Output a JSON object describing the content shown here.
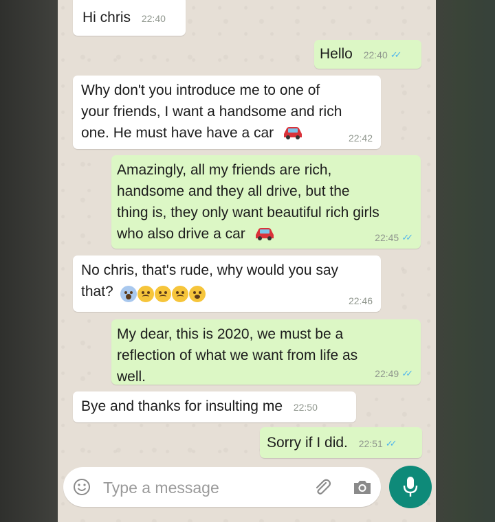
{
  "messages": [
    {
      "direction": "incoming",
      "text": "Hi chris",
      "time": "22:40"
    },
    {
      "direction": "outgoing",
      "text": "Hello",
      "time": "22:40",
      "status": "read"
    },
    {
      "direction": "incoming",
      "text": "Why don't you introduce me to one of\nyour friends, I want a handsome and rich\none. He must have have a car",
      "time": "22:42",
      "emoji": [
        "car-emoji"
      ]
    },
    {
      "direction": "outgoing",
      "text": "Amazingly, all my friends are rich,\nhandsome and they all drive, but the\nthing is, they only want beautiful rich girls\nwho also drive a car",
      "time": "22:45",
      "status": "read",
      "emoji": [
        "car-emoji"
      ]
    },
    {
      "direction": "incoming",
      "text": "No chris, that's rude, why would you say\nthat?",
      "time": "22:46",
      "emoji": [
        "screaming-face-emoji",
        "disappointed-face-emoji",
        "disappointed-face-emoji",
        "disappointed-face-emoji",
        "dizzy-face-emoji"
      ]
    },
    {
      "direction": "outgoing",
      "text": "My dear, this is 2020, we must be a\nreflection of what we want from life as\nwell.",
      "time": "22:49",
      "status": "read"
    },
    {
      "direction": "incoming",
      "text": "Bye and thanks for insulting me",
      "time": "22:50"
    },
    {
      "direction": "outgoing",
      "text": "Sorry if I did.",
      "time": "22:51",
      "status": "read"
    }
  ],
  "composer": {
    "placeholder": "Type a message",
    "value": "",
    "icons": [
      "emoji-icon",
      "attach-icon",
      "camera-icon",
      "mic-icon"
    ]
  },
  "colors": {
    "outgoing_bubble": "#dcf7c5",
    "incoming_bubble": "#ffffff",
    "chat_background": "#e6dfd6",
    "read_ticks": "#4fb5ec",
    "mic_button": "#0e8a79"
  }
}
